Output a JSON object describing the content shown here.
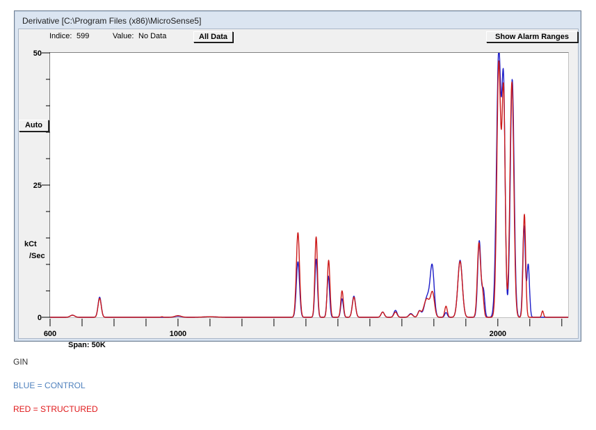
{
  "window": {
    "title": "Derivative [C:\\Program Files (x86)\\MicroSense5]"
  },
  "infobar": {
    "indice_label": "Indice:",
    "indice_value": "599",
    "value_label": "Value:",
    "value_value": "No Data",
    "all_data_button": "All Data",
    "show_alarm_button": "Show Alarm Ranges"
  },
  "controls": {
    "auto_button": "Auto"
  },
  "chart_data": {
    "type": "line",
    "xlabel": "",
    "ylabel_line1": "kCt",
    "ylabel_line2": "/Sec",
    "xlim": [
      600,
      2220
    ],
    "ylim": [
      0,
      50
    ],
    "y_ticks": [
      0,
      25,
      50
    ],
    "x_ticks": [
      600,
      1000,
      2000
    ],
    "span_label": "Span:",
    "span_value": "50K",
    "grid": false,
    "colors": {
      "control": "#1d1dc8",
      "structured": "#cc1a1a"
    },
    "series": [
      {
        "key": "control",
        "peaks": [
          [
            670,
            0.4,
            7
          ],
          [
            755,
            3.8,
            5
          ],
          [
            1000,
            0.2,
            10
          ],
          [
            1100,
            0.1,
            20
          ],
          [
            1375,
            10.5,
            5
          ],
          [
            1432,
            11.0,
            4
          ],
          [
            1470,
            7.8,
            4
          ],
          [
            1513,
            3.5,
            4
          ],
          [
            1550,
            4.0,
            5
          ],
          [
            1640,
            1.0,
            5
          ],
          [
            1680,
            1.3,
            5
          ],
          [
            1728,
            0.7,
            6
          ],
          [
            1755,
            1.2,
            5
          ],
          [
            1780,
            4.0,
            9
          ],
          [
            1795,
            9.0,
            6
          ],
          [
            1838,
            0.9,
            4
          ],
          [
            1882,
            10.8,
            7
          ],
          [
            1942,
            14.5,
            5
          ],
          [
            1955,
            5.0,
            4
          ],
          [
            2003,
            50.5,
            7
          ],
          [
            2018,
            41.0,
            5
          ],
          [
            2045,
            45.0,
            6
          ],
          [
            2082,
            17.3,
            4
          ],
          [
            2095,
            10.0,
            4
          ]
        ]
      },
      {
        "key": "structured",
        "peaks": [
          [
            670,
            0.4,
            7
          ],
          [
            755,
            3.6,
            5
          ],
          [
            950,
            0.1,
            3
          ],
          [
            1000,
            0.3,
            10
          ],
          [
            1100,
            0.1,
            20
          ],
          [
            1375,
            16.0,
            5
          ],
          [
            1432,
            15.2,
            4
          ],
          [
            1471,
            10.8,
            4
          ],
          [
            1513,
            5.0,
            4
          ],
          [
            1550,
            3.8,
            5
          ],
          [
            1640,
            1.0,
            5
          ],
          [
            1680,
            1.0,
            5
          ],
          [
            1728,
            0.6,
            6
          ],
          [
            1755,
            1.1,
            5
          ],
          [
            1778,
            3.5,
            9
          ],
          [
            1796,
            4.4,
            6
          ],
          [
            1838,
            2.1,
            4
          ],
          [
            1882,
            10.6,
            7
          ],
          [
            1941,
            14.0,
            5
          ],
          [
            1952,
            4.5,
            4
          ],
          [
            2003,
            48.0,
            6
          ],
          [
            2018,
            42.0,
            5
          ],
          [
            2044,
            44.5,
            6
          ],
          [
            2083,
            19.5,
            4
          ],
          [
            2140,
            1.2,
            3
          ]
        ]
      }
    ]
  },
  "legend": {
    "heading": "GIN",
    "control_label": "BLUE = CONTROL",
    "structured_label": "RED = STRUCTURED",
    "control_color": "#4f81bd",
    "structured_color": "#e0181a"
  }
}
